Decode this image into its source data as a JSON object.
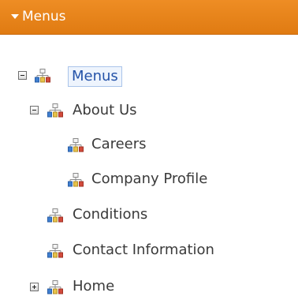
{
  "header": {
    "title": "Menus",
    "caret_icon": "caret-down-icon"
  },
  "tree": {
    "node_icon": "sitemap-icon",
    "nodes": [
      {
        "label": "Menus",
        "toggle": "collapse",
        "selected": true
      },
      {
        "label": "About Us",
        "toggle": "collapse"
      },
      {
        "label": "Careers"
      },
      {
        "label": "Company Profile"
      },
      {
        "label": "Conditions"
      },
      {
        "label": "Contact Information"
      },
      {
        "label": "Home",
        "toggle": "expand"
      }
    ]
  },
  "colors": {
    "header_bg": "#e9851b",
    "selected_text": "#2452a8",
    "selected_border": "#aac4ea",
    "icon_blue": "#3f7fd0",
    "icon_yellow": "#e8c24a",
    "icon_red": "#d24a3b"
  }
}
